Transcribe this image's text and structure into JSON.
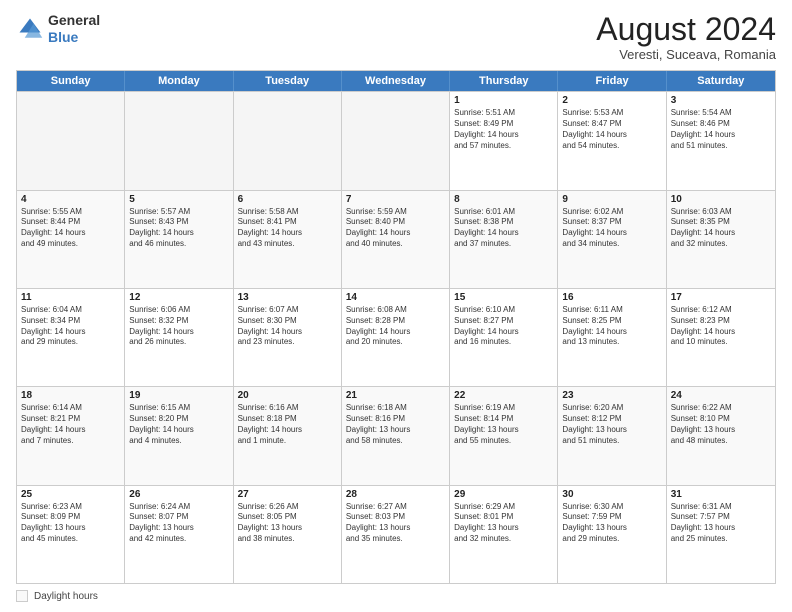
{
  "logo": {
    "general": "General",
    "blue": "Blue"
  },
  "title": "August 2024",
  "subtitle": "Veresti, Suceava, Romania",
  "header_days": [
    "Sunday",
    "Monday",
    "Tuesday",
    "Wednesday",
    "Thursday",
    "Friday",
    "Saturday"
  ],
  "legend_label": "Daylight hours",
  "weeks": [
    [
      {
        "day": "",
        "info": "",
        "empty": true
      },
      {
        "day": "",
        "info": "",
        "empty": true
      },
      {
        "day": "",
        "info": "",
        "empty": true
      },
      {
        "day": "",
        "info": "",
        "empty": true
      },
      {
        "day": "1",
        "info": "Sunrise: 5:51 AM\nSunset: 8:49 PM\nDaylight: 14 hours\nand 57 minutes."
      },
      {
        "day": "2",
        "info": "Sunrise: 5:53 AM\nSunset: 8:47 PM\nDaylight: 14 hours\nand 54 minutes."
      },
      {
        "day": "3",
        "info": "Sunrise: 5:54 AM\nSunset: 8:46 PM\nDaylight: 14 hours\nand 51 minutes."
      }
    ],
    [
      {
        "day": "4",
        "info": "Sunrise: 5:55 AM\nSunset: 8:44 PM\nDaylight: 14 hours\nand 49 minutes."
      },
      {
        "day": "5",
        "info": "Sunrise: 5:57 AM\nSunset: 8:43 PM\nDaylight: 14 hours\nand 46 minutes."
      },
      {
        "day": "6",
        "info": "Sunrise: 5:58 AM\nSunset: 8:41 PM\nDaylight: 14 hours\nand 43 minutes."
      },
      {
        "day": "7",
        "info": "Sunrise: 5:59 AM\nSunset: 8:40 PM\nDaylight: 14 hours\nand 40 minutes."
      },
      {
        "day": "8",
        "info": "Sunrise: 6:01 AM\nSunset: 8:38 PM\nDaylight: 14 hours\nand 37 minutes."
      },
      {
        "day": "9",
        "info": "Sunrise: 6:02 AM\nSunset: 8:37 PM\nDaylight: 14 hours\nand 34 minutes."
      },
      {
        "day": "10",
        "info": "Sunrise: 6:03 AM\nSunset: 8:35 PM\nDaylight: 14 hours\nand 32 minutes."
      }
    ],
    [
      {
        "day": "11",
        "info": "Sunrise: 6:04 AM\nSunset: 8:34 PM\nDaylight: 14 hours\nand 29 minutes."
      },
      {
        "day": "12",
        "info": "Sunrise: 6:06 AM\nSunset: 8:32 PM\nDaylight: 14 hours\nand 26 minutes."
      },
      {
        "day": "13",
        "info": "Sunrise: 6:07 AM\nSunset: 8:30 PM\nDaylight: 14 hours\nand 23 minutes."
      },
      {
        "day": "14",
        "info": "Sunrise: 6:08 AM\nSunset: 8:28 PM\nDaylight: 14 hours\nand 20 minutes."
      },
      {
        "day": "15",
        "info": "Sunrise: 6:10 AM\nSunset: 8:27 PM\nDaylight: 14 hours\nand 16 minutes."
      },
      {
        "day": "16",
        "info": "Sunrise: 6:11 AM\nSunset: 8:25 PM\nDaylight: 14 hours\nand 13 minutes."
      },
      {
        "day": "17",
        "info": "Sunrise: 6:12 AM\nSunset: 8:23 PM\nDaylight: 14 hours\nand 10 minutes."
      }
    ],
    [
      {
        "day": "18",
        "info": "Sunrise: 6:14 AM\nSunset: 8:21 PM\nDaylight: 14 hours\nand 7 minutes."
      },
      {
        "day": "19",
        "info": "Sunrise: 6:15 AM\nSunset: 8:20 PM\nDaylight: 14 hours\nand 4 minutes."
      },
      {
        "day": "20",
        "info": "Sunrise: 6:16 AM\nSunset: 8:18 PM\nDaylight: 14 hours\nand 1 minute."
      },
      {
        "day": "21",
        "info": "Sunrise: 6:18 AM\nSunset: 8:16 PM\nDaylight: 13 hours\nand 58 minutes."
      },
      {
        "day": "22",
        "info": "Sunrise: 6:19 AM\nSunset: 8:14 PM\nDaylight: 13 hours\nand 55 minutes."
      },
      {
        "day": "23",
        "info": "Sunrise: 6:20 AM\nSunset: 8:12 PM\nDaylight: 13 hours\nand 51 minutes."
      },
      {
        "day": "24",
        "info": "Sunrise: 6:22 AM\nSunset: 8:10 PM\nDaylight: 13 hours\nand 48 minutes."
      }
    ],
    [
      {
        "day": "25",
        "info": "Sunrise: 6:23 AM\nSunset: 8:09 PM\nDaylight: 13 hours\nand 45 minutes."
      },
      {
        "day": "26",
        "info": "Sunrise: 6:24 AM\nSunset: 8:07 PM\nDaylight: 13 hours\nand 42 minutes."
      },
      {
        "day": "27",
        "info": "Sunrise: 6:26 AM\nSunset: 8:05 PM\nDaylight: 13 hours\nand 38 minutes."
      },
      {
        "day": "28",
        "info": "Sunrise: 6:27 AM\nSunset: 8:03 PM\nDaylight: 13 hours\nand 35 minutes."
      },
      {
        "day": "29",
        "info": "Sunrise: 6:29 AM\nSunset: 8:01 PM\nDaylight: 13 hours\nand 32 minutes."
      },
      {
        "day": "30",
        "info": "Sunrise: 6:30 AM\nSunset: 7:59 PM\nDaylight: 13 hours\nand 29 minutes."
      },
      {
        "day": "31",
        "info": "Sunrise: 6:31 AM\nSunset: 7:57 PM\nDaylight: 13 hours\nand 25 minutes."
      }
    ]
  ]
}
